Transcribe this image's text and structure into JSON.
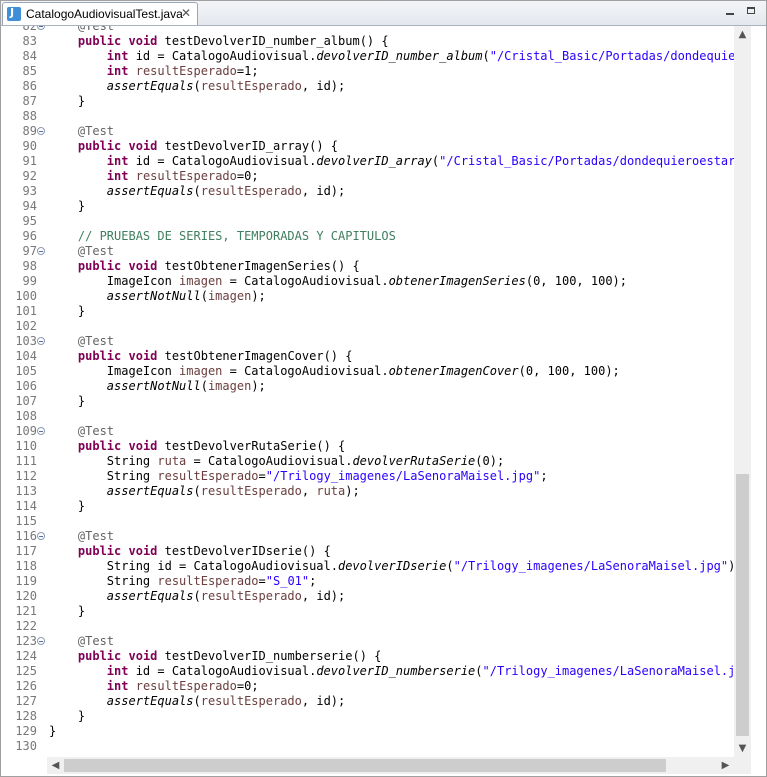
{
  "tab": {
    "title": "CatalogoAudiovisualTest.java",
    "close": "✕",
    "icon": "java-file-icon"
  },
  "window_buttons": {
    "minimize": "minimize-icon",
    "maximize": "maximize-icon"
  },
  "scrollbars": {
    "up": "▲",
    "down": "▼",
    "left": "◀",
    "right": "▶"
  },
  "editor": {
    "lines": [
      {
        "n": "82",
        "fold": true,
        "code": [
          {
            "t": "    "
          },
          {
            "t": "@Test",
            "c": "ann"
          }
        ]
      },
      {
        "n": "83",
        "code": [
          {
            "t": "    "
          },
          {
            "t": "public",
            "c": "kw"
          },
          {
            "t": " "
          },
          {
            "t": "void",
            "c": "kw"
          },
          {
            "t": " testDevolverID_number_album() {"
          }
        ]
      },
      {
        "n": "84",
        "code": [
          {
            "t": "        "
          },
          {
            "t": "int",
            "c": "kw"
          },
          {
            "t": " id = CatalogoAudiovisual."
          },
          {
            "t": "devolverID_number_album",
            "c": "ital"
          },
          {
            "t": "("
          },
          {
            "t": "\"/Cristal_Basic/Portadas/dondequieroe",
            "c": "str"
          }
        ]
      },
      {
        "n": "85",
        "code": [
          {
            "t": "        "
          },
          {
            "t": "int",
            "c": "kw"
          },
          {
            "t": " "
          },
          {
            "t": "resultEsperado",
            "c": "fld"
          },
          {
            "t": "=1;"
          }
        ]
      },
      {
        "n": "86",
        "code": [
          {
            "t": "        "
          },
          {
            "t": "assertEquals",
            "c": "ital"
          },
          {
            "t": "("
          },
          {
            "t": "resultEsperado",
            "c": "fld"
          },
          {
            "t": ", id);"
          }
        ]
      },
      {
        "n": "87",
        "code": [
          {
            "t": "    }"
          }
        ]
      },
      {
        "n": "88",
        "code": []
      },
      {
        "n": "89",
        "fold": true,
        "code": [
          {
            "t": "    "
          },
          {
            "t": "@Test",
            "c": "ann"
          }
        ]
      },
      {
        "n": "90",
        "code": [
          {
            "t": "    "
          },
          {
            "t": "public",
            "c": "kw"
          },
          {
            "t": " "
          },
          {
            "t": "void",
            "c": "kw"
          },
          {
            "t": " testDevolverID_array() {"
          }
        ]
      },
      {
        "n": "91",
        "code": [
          {
            "t": "        "
          },
          {
            "t": "int",
            "c": "kw"
          },
          {
            "t": " id = CatalogoAudiovisual."
          },
          {
            "t": "devolverID_array",
            "c": "ital"
          },
          {
            "t": "("
          },
          {
            "t": "\"/Cristal_Basic/Portadas/dondequieroestar.pn",
            "c": "str"
          }
        ]
      },
      {
        "n": "92",
        "code": [
          {
            "t": "        "
          },
          {
            "t": "int",
            "c": "kw"
          },
          {
            "t": " "
          },
          {
            "t": "resultEsperado",
            "c": "fld"
          },
          {
            "t": "=0;"
          }
        ]
      },
      {
        "n": "93",
        "code": [
          {
            "t": "        "
          },
          {
            "t": "assertEquals",
            "c": "ital"
          },
          {
            "t": "("
          },
          {
            "t": "resultEsperado",
            "c": "fld"
          },
          {
            "t": ", id);"
          }
        ]
      },
      {
        "n": "94",
        "code": [
          {
            "t": "    }"
          }
        ]
      },
      {
        "n": "95",
        "code": []
      },
      {
        "n": "96",
        "code": [
          {
            "t": "    "
          },
          {
            "t": "// PRUEBAS DE SERIES, TEMPORADAS Y CAPITULOS",
            "c": "cmt"
          }
        ]
      },
      {
        "n": "97",
        "fold": true,
        "code": [
          {
            "t": "    "
          },
          {
            "t": "@Test",
            "c": "ann"
          }
        ]
      },
      {
        "n": "98",
        "code": [
          {
            "t": "    "
          },
          {
            "t": "public",
            "c": "kw"
          },
          {
            "t": " "
          },
          {
            "t": "void",
            "c": "kw"
          },
          {
            "t": " testObtenerImagenSeries() {"
          }
        ]
      },
      {
        "n": "99",
        "code": [
          {
            "t": "        ImageIcon "
          },
          {
            "t": "imagen",
            "c": "fld"
          },
          {
            "t": " = CatalogoAudiovisual."
          },
          {
            "t": "obtenerImagenSeries",
            "c": "ital"
          },
          {
            "t": "(0, 100, 100);"
          }
        ]
      },
      {
        "n": "100",
        "code": [
          {
            "t": "        "
          },
          {
            "t": "assertNotNull",
            "c": "ital"
          },
          {
            "t": "("
          },
          {
            "t": "imagen",
            "c": "fld"
          },
          {
            "t": ");"
          }
        ]
      },
      {
        "n": "101",
        "code": [
          {
            "t": "    }"
          }
        ]
      },
      {
        "n": "102",
        "code": []
      },
      {
        "n": "103",
        "fold": true,
        "code": [
          {
            "t": "    "
          },
          {
            "t": "@Test",
            "c": "ann"
          }
        ]
      },
      {
        "n": "104",
        "code": [
          {
            "t": "    "
          },
          {
            "t": "public",
            "c": "kw"
          },
          {
            "t": " "
          },
          {
            "t": "void",
            "c": "kw"
          },
          {
            "t": " testObtenerImagenCover() {"
          }
        ]
      },
      {
        "n": "105",
        "code": [
          {
            "t": "        ImageIcon "
          },
          {
            "t": "imagen",
            "c": "fld"
          },
          {
            "t": " = CatalogoAudiovisual."
          },
          {
            "t": "obtenerImagenCover",
            "c": "ital"
          },
          {
            "t": "(0, 100, 100);"
          }
        ]
      },
      {
        "n": "106",
        "code": [
          {
            "t": "        "
          },
          {
            "t": "assertNotNull",
            "c": "ital"
          },
          {
            "t": "("
          },
          {
            "t": "imagen",
            "c": "fld"
          },
          {
            "t": ");"
          }
        ]
      },
      {
        "n": "107",
        "code": [
          {
            "t": "    }"
          }
        ]
      },
      {
        "n": "108",
        "code": []
      },
      {
        "n": "109",
        "fold": true,
        "code": [
          {
            "t": "    "
          },
          {
            "t": "@Test",
            "c": "ann"
          }
        ]
      },
      {
        "n": "110",
        "code": [
          {
            "t": "    "
          },
          {
            "t": "public",
            "c": "kw"
          },
          {
            "t": " "
          },
          {
            "t": "void",
            "c": "kw"
          },
          {
            "t": " testDevolverRutaSerie() {"
          }
        ]
      },
      {
        "n": "111",
        "code": [
          {
            "t": "        String "
          },
          {
            "t": "ruta",
            "c": "fld"
          },
          {
            "t": " = CatalogoAudiovisual."
          },
          {
            "t": "devolverRutaSerie",
            "c": "ital"
          },
          {
            "t": "(0);"
          }
        ]
      },
      {
        "n": "112",
        "code": [
          {
            "t": "        String "
          },
          {
            "t": "resultEsperado",
            "c": "fld"
          },
          {
            "t": "="
          },
          {
            "t": "\"/Trilogy_imagenes/LaSenoraMaisel.jpg\"",
            "c": "str"
          },
          {
            "t": ";"
          }
        ]
      },
      {
        "n": "113",
        "code": [
          {
            "t": "        "
          },
          {
            "t": "assertEquals",
            "c": "ital"
          },
          {
            "t": "("
          },
          {
            "t": "resultEsperado",
            "c": "fld"
          },
          {
            "t": ", "
          },
          {
            "t": "ruta",
            "c": "fld"
          },
          {
            "t": ");"
          }
        ]
      },
      {
        "n": "114",
        "code": [
          {
            "t": "    }"
          }
        ]
      },
      {
        "n": "115",
        "code": []
      },
      {
        "n": "116",
        "fold": true,
        "code": [
          {
            "t": "    "
          },
          {
            "t": "@Test",
            "c": "ann"
          }
        ]
      },
      {
        "n": "117",
        "code": [
          {
            "t": "    "
          },
          {
            "t": "public",
            "c": "kw"
          },
          {
            "t": " "
          },
          {
            "t": "void",
            "c": "kw"
          },
          {
            "t": " testDevolverIDserie() {"
          }
        ]
      },
      {
        "n": "118",
        "code": [
          {
            "t": "        String id = CatalogoAudiovisual."
          },
          {
            "t": "devolverIDserie",
            "c": "ital"
          },
          {
            "t": "("
          },
          {
            "t": "\"/Trilogy_imagenes/LaSenoraMaisel.jpg\"",
            "c": "str"
          },
          {
            "t": ");"
          }
        ]
      },
      {
        "n": "119",
        "code": [
          {
            "t": "        String "
          },
          {
            "t": "resultEsperado",
            "c": "fld"
          },
          {
            "t": "="
          },
          {
            "t": "\"S_01\"",
            "c": "str"
          },
          {
            "t": ";"
          }
        ]
      },
      {
        "n": "120",
        "code": [
          {
            "t": "        "
          },
          {
            "t": "assertEquals",
            "c": "ital"
          },
          {
            "t": "("
          },
          {
            "t": "resultEsperado",
            "c": "fld"
          },
          {
            "t": ", id);"
          }
        ]
      },
      {
        "n": "121",
        "code": [
          {
            "t": "    }"
          }
        ]
      },
      {
        "n": "122",
        "code": []
      },
      {
        "n": "123",
        "fold": true,
        "code": [
          {
            "t": "    "
          },
          {
            "t": "@Test",
            "c": "ann"
          }
        ]
      },
      {
        "n": "124",
        "code": [
          {
            "t": "    "
          },
          {
            "t": "public",
            "c": "kw"
          },
          {
            "t": " "
          },
          {
            "t": "void",
            "c": "kw"
          },
          {
            "t": " testDevolverID_numberserie() {"
          }
        ]
      },
      {
        "n": "125",
        "code": [
          {
            "t": "        "
          },
          {
            "t": "int",
            "c": "kw"
          },
          {
            "t": " id = CatalogoAudiovisual."
          },
          {
            "t": "devolverID_numberserie",
            "c": "ital"
          },
          {
            "t": "("
          },
          {
            "t": "\"/Trilogy_imagenes/LaSenoraMaisel.jpg\"",
            "c": "str"
          }
        ]
      },
      {
        "n": "126",
        "code": [
          {
            "t": "        "
          },
          {
            "t": "int",
            "c": "kw"
          },
          {
            "t": " "
          },
          {
            "t": "resultEsperado",
            "c": "fld"
          },
          {
            "t": "=0;"
          }
        ]
      },
      {
        "n": "127",
        "code": [
          {
            "t": "        "
          },
          {
            "t": "assertEquals",
            "c": "ital"
          },
          {
            "t": "("
          },
          {
            "t": "resultEsperado",
            "c": "fld"
          },
          {
            "t": ", id);"
          }
        ]
      },
      {
        "n": "128",
        "code": [
          {
            "t": "    }"
          }
        ]
      },
      {
        "n": "129",
        "code": [
          {
            "t": "}"
          }
        ]
      },
      {
        "n": "130",
        "code": []
      }
    ]
  }
}
